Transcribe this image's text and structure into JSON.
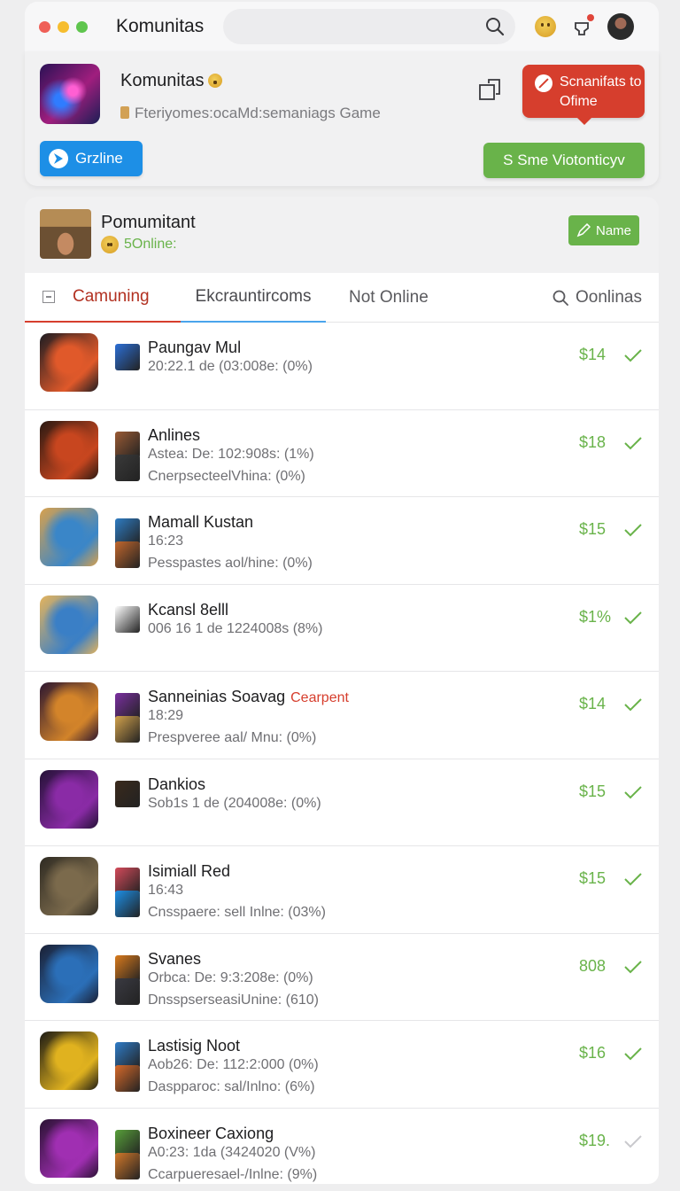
{
  "colors": {
    "accent_red": "#d63e2d",
    "accent_green": "#69b34a",
    "accent_blue": "#1d8fe6"
  },
  "titlebar": {
    "app_title": "Komunitas",
    "search": {
      "value": "",
      "placeholder": ""
    },
    "icons": [
      "search-icon",
      "emoji-icon",
      "notification-icon",
      "user-avatar"
    ]
  },
  "header_card": {
    "title": "Komunitas",
    "subtitle": "Fteriyomes:ocaMd:semaniags Game",
    "callout_button": "Scnanifats to Ofime",
    "online_button": "Grzline",
    "action_button": "S Sme Viotonticyv"
  },
  "profile": {
    "name": "Pomumitant",
    "status": "5Online:",
    "edit_button": "Name"
  },
  "tabs": [
    {
      "label": "Camuning",
      "active": true
    },
    {
      "label": "Ekcrauntircoms",
      "active": false
    },
    {
      "label": "Not Online",
      "active": false
    },
    {
      "label": "Oonlinas",
      "active": false
    }
  ],
  "games": [
    {
      "title": "Paungav Mul",
      "tag": "",
      "line1": "20:22.1 de (03:008e: (0%)",
      "line2": "",
      "price": "$14",
      "c1": "#e0592a",
      "c2": "#1c1c22",
      "m1": "#2c6fd6",
      "m2": ""
    },
    {
      "title": "Anlines",
      "tag": "",
      "line1": "Astea: De: 102:908s: (1%)",
      "line2": "CnerpsecteelVhina: (0%)",
      "price": "$18",
      "c1": "#c8461f",
      "c2": "#2a1912",
      "m1": "#9a5a34",
      "m2": "#3a3a3a"
    },
    {
      "title": "Mamall Kustan",
      "tag": "",
      "line1": "16:23",
      "line2": "Pesspastes aol/hine: (0%)",
      "price": "$15",
      "c1": "#3a86c8",
      "c2": "#d9a14c",
      "m1": "#2e7cc3",
      "m2": "#c2672d"
    },
    {
      "title": "Kcansl 8elll",
      "tag": "",
      "line1": "006 16 1 de 1224008s (8%)",
      "line2": "",
      "price": "$1%",
      "c1": "#3a7fc6",
      "c2": "#e6b45b",
      "m1": "#ffffff",
      "m2": ""
    },
    {
      "title": "Sanneinias Soavag",
      "tag": "Cearpent",
      "line1": "18:29",
      "line2": "Prespveree aal/ Mnu: (0%)",
      "price": "$14",
      "c1": "#d3842a",
      "c2": "#2c1630",
      "m1": "#7a2fa0",
      "m2": "#d2a24c"
    },
    {
      "title": "Dankios",
      "tag": "",
      "line1": "Sob1s 1 de (204008e: (0%)",
      "line2": "",
      "price": "$15",
      "c1": "#8a2ba6",
      "c2": "#241136",
      "m1": "#3a2a1c",
      "m2": ""
    },
    {
      "title": "Isimiall Red",
      "tag": "",
      "line1": "16:43",
      "line2": "Cnsspaere: sell Inlne: (03%)",
      "price": "$15",
      "c1": "#7b6a4c",
      "c2": "#2e2a22",
      "m1": "#d44a5a",
      "m2": "#1d8fe6"
    },
    {
      "title": "Svanes",
      "tag": "",
      "line1": "Orbca: De: 9:3:208e: (0%)",
      "line2": "DnsspserseasiUnine: (610)",
      "price": "808",
      "c1": "#2b6fb8",
      "c2": "#1a1f33",
      "m1": "#d97a1c",
      "m2": "#3a3a42"
    },
    {
      "title": "Lastisig Noot",
      "tag": "",
      "line1": "Aob26: De: 112:2:000 (0%)",
      "line2": "Daspparoc: sal/Inlno: (6%)",
      "price": "$16",
      "c1": "#e0b21f",
      "c2": "#1c1a14",
      "m1": "#2f7cc8",
      "m2": "#d76a2a"
    },
    {
      "title": "Boxineer Caxiong",
      "tag": "",
      "line1": "A0:23: 1da (3424020 (V%)",
      "line2": "Ccarpueresael-/Inlne: (9%)",
      "price": "$19.",
      "c1": "#a02fb2",
      "c2": "#2a1233",
      "m1": "#58a03a",
      "m2": "#d2782a"
    }
  ]
}
